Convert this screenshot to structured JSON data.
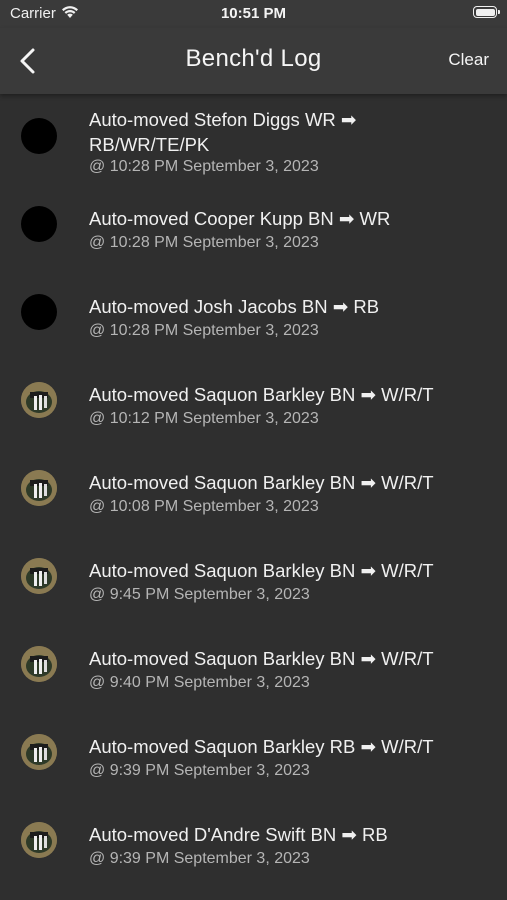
{
  "status": {
    "carrier": "Carrier",
    "time": "10:51 PM"
  },
  "nav": {
    "title": "Bench'd Log",
    "clear_label": "Clear"
  },
  "entries": [
    {
      "message": "Auto-moved Stefon Diggs WR ➡ RB/WR/TE/PK",
      "timestamp": "@ 10:28 PM September 3, 2023",
      "avatar": "blank"
    },
    {
      "message": "Auto-moved Cooper Kupp BN ➡ WR",
      "timestamp": "@ 10:28 PM September 3, 2023",
      "avatar": "blank"
    },
    {
      "message": "Auto-moved Josh Jacobs BN ➡ RB",
      "timestamp": "@ 10:28 PM September 3, 2023",
      "avatar": "blank"
    },
    {
      "message": "Auto-moved Saquon Barkley BN ➡ W/R/T",
      "timestamp": "@ 10:12 PM September 3, 2023",
      "avatar": "player-photo"
    },
    {
      "message": "Auto-moved Saquon Barkley BN ➡ W/R/T",
      "timestamp": "@ 10:08 PM September 3, 2023",
      "avatar": "player-photo"
    },
    {
      "message": "Auto-moved Saquon Barkley BN ➡ W/R/T",
      "timestamp": "@ 9:45 PM September 3, 2023",
      "avatar": "player-photo"
    },
    {
      "message": "Auto-moved Saquon Barkley BN ➡ W/R/T",
      "timestamp": "@ 9:40 PM September 3, 2023",
      "avatar": "player-photo"
    },
    {
      "message": "Auto-moved Saquon Barkley RB ➡ W/R/T",
      "timestamp": "@ 9:39 PM September 3, 2023",
      "avatar": "player-photo"
    },
    {
      "message": "Auto-moved D'Andre Swift BN ➡ RB",
      "timestamp": "@ 9:39 PM September 3, 2023",
      "avatar": "player-photo"
    }
  ]
}
